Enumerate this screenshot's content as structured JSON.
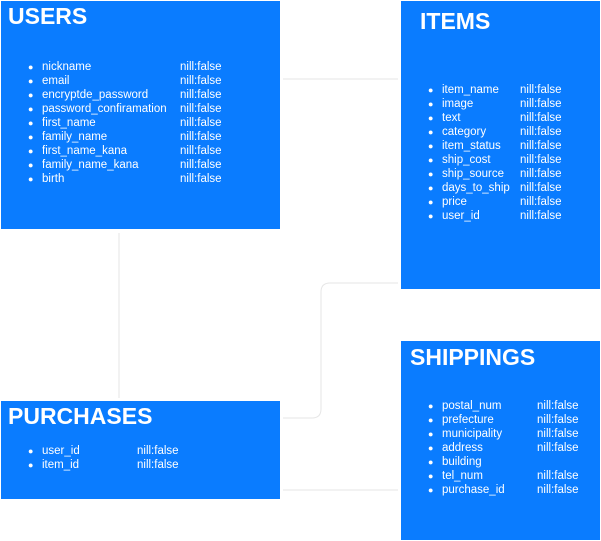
{
  "entities": {
    "users": {
      "title": "USERS",
      "fields": [
        {
          "name": "nickname",
          "constraint": "nill:false"
        },
        {
          "name": "email",
          "constraint": "nill:false"
        },
        {
          "name": "encryptde_password",
          "constraint": "nill:false"
        },
        {
          "name": "password_confiramation",
          "constraint": "nill:false"
        },
        {
          "name": "first_name",
          "constraint": "nill:false"
        },
        {
          "name": "family_name",
          "constraint": "nill:false"
        },
        {
          "name": "first_name_kana",
          "constraint": "nill:false"
        },
        {
          "name": "family_name_kana",
          "constraint": "nill:false"
        },
        {
          "name": "birth",
          "constraint": "nill:false"
        }
      ]
    },
    "items": {
      "title": "ITEMS",
      "fields": [
        {
          "name": "item_name",
          "constraint": "nill:false"
        },
        {
          "name": "image",
          "constraint": "nill:false"
        },
        {
          "name": "text",
          "constraint": "nill:false"
        },
        {
          "name": "category",
          "constraint": "nill:false"
        },
        {
          "name": "item_status",
          "constraint": "nill:false"
        },
        {
          "name": "ship_cost",
          "constraint": "nill:false"
        },
        {
          "name": "ship_source",
          "constraint": "nill:false"
        },
        {
          "name": "days_to_ship",
          "constraint": "nill:false"
        },
        {
          "name": "price",
          "constraint": "nill:false"
        },
        {
          "name": "user_id",
          "constraint": "nill:false"
        }
      ]
    },
    "purchases": {
      "title": "PURCHASES",
      "fields": [
        {
          "name": "user_id",
          "constraint": "nill:false"
        },
        {
          "name": "item_id",
          "constraint": "nill:false"
        }
      ]
    },
    "shippings": {
      "title": "SHIPPINGS",
      "fields": [
        {
          "name": "postal_num",
          "constraint": "nill:false"
        },
        {
          "name": "prefecture",
          "constraint": "nill:false"
        },
        {
          "name": "municipality",
          "constraint": "nill:false"
        },
        {
          "name": "address",
          "constraint": "nill:false"
        },
        {
          "name": "building",
          "constraint": ""
        },
        {
          "name": "tel_num",
          "constraint": "nill:false"
        },
        {
          "name": "purchase_id",
          "constraint": "nill:false"
        }
      ]
    }
  },
  "colors": {
    "entity_fill": "#0a7cff",
    "entity_text": "#ffffff",
    "connector": "#e6e6e6"
  }
}
